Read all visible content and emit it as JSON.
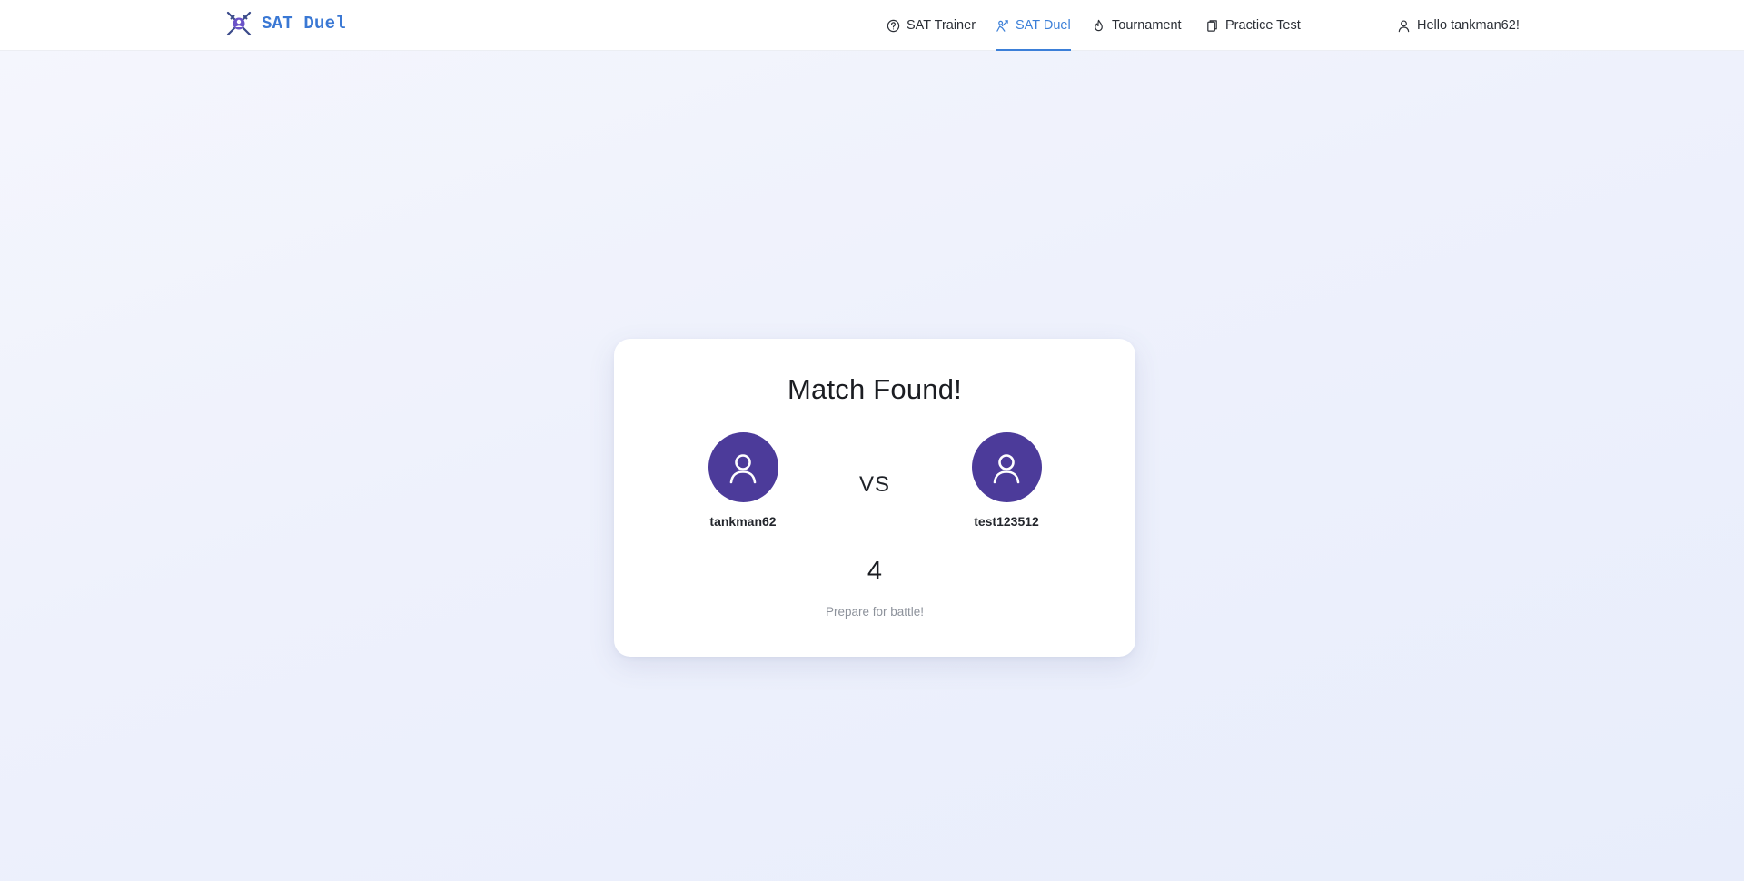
{
  "header": {
    "brand": "SAT Duel",
    "nav": [
      {
        "label": "SAT Trainer",
        "icon": "help-circle-icon",
        "active": false
      },
      {
        "label": "SAT Duel",
        "icon": "duel-icon",
        "active": true
      },
      {
        "label": "Tournament",
        "icon": "flame-icon",
        "active": false
      },
      {
        "label": "Practice Test",
        "icon": "document-copy-icon",
        "active": false
      }
    ],
    "user_greeting": "Hello tankman62!",
    "user_icon": "user-icon"
  },
  "match": {
    "title": "Match Found!",
    "player_left": {
      "name": "tankman62",
      "icon": "user-icon"
    },
    "vs_label": "VS",
    "player_right": {
      "name": "test123512",
      "icon": "user-icon"
    },
    "countdown": "4",
    "subtitle": "Prepare for battle!"
  },
  "colors": {
    "accent": "#3b7fd8",
    "avatar": "#4c3b9a",
    "brand": "#3a78d4"
  }
}
